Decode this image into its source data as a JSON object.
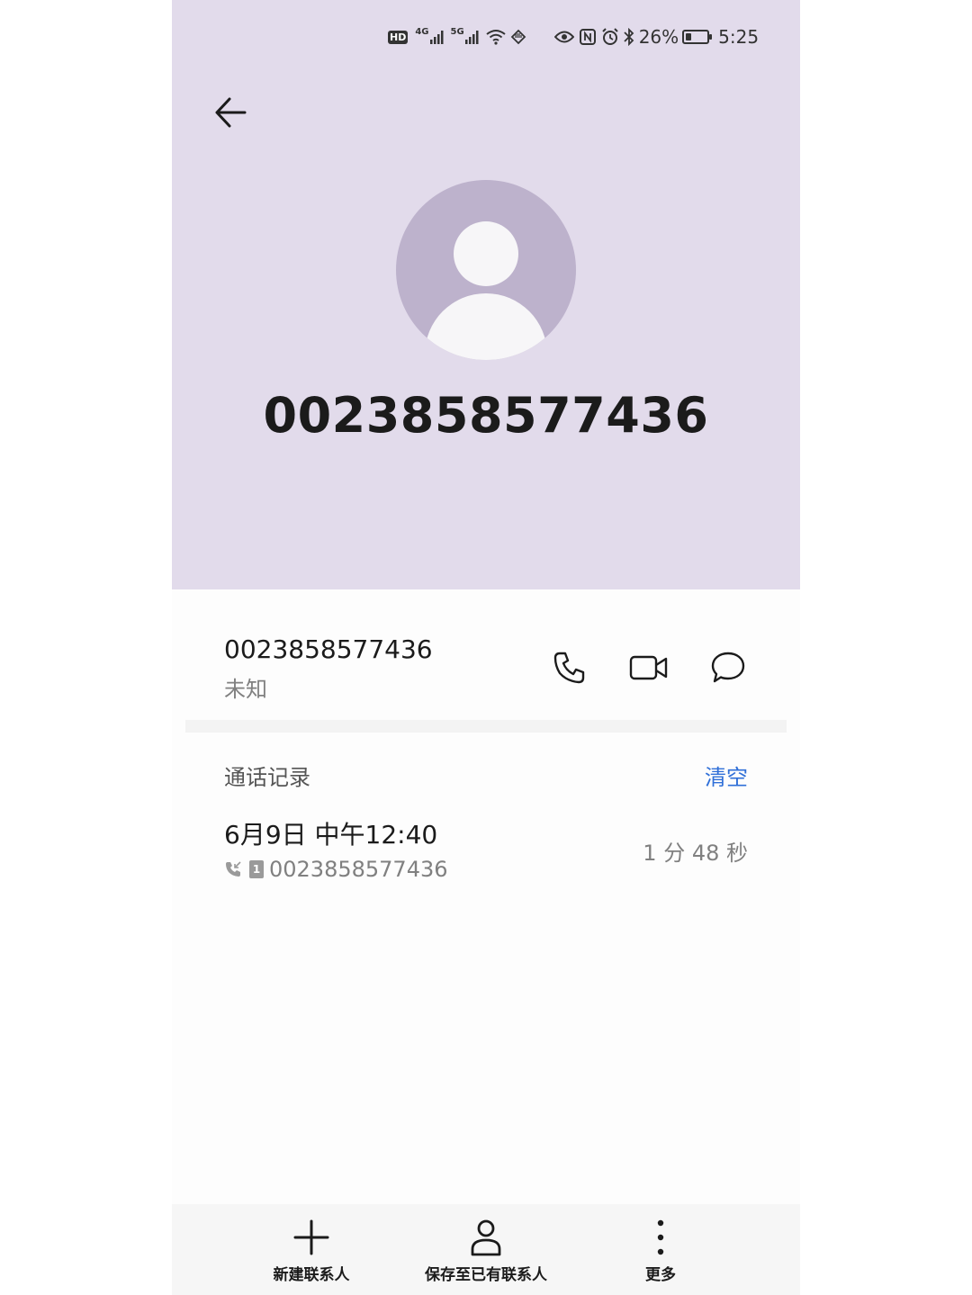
{
  "status_bar": {
    "hd_label": "HD",
    "net1": "4G",
    "net2": "5G",
    "battery_text": "26%",
    "battery_level": 0.26,
    "time": "5:25"
  },
  "contact": {
    "number": "0023858577436",
    "number_row": "0023858577436",
    "location": "未知"
  },
  "call_log": {
    "section_title": "通话记录",
    "clear_label": "清空",
    "entries": [
      {
        "datetime": "6月9日 中午12:40",
        "number": "0023858577436",
        "sim": "1",
        "duration": "1 分 48 秒"
      }
    ]
  },
  "bottom_bar": {
    "new_contact": "新建联系人",
    "save_existing": "保存至已有联系人",
    "more": "更多"
  },
  "colors": {
    "header_bg": "#e2dbeb",
    "avatar_bg": "#bdb2cc",
    "accent": "#2f6fd8"
  }
}
